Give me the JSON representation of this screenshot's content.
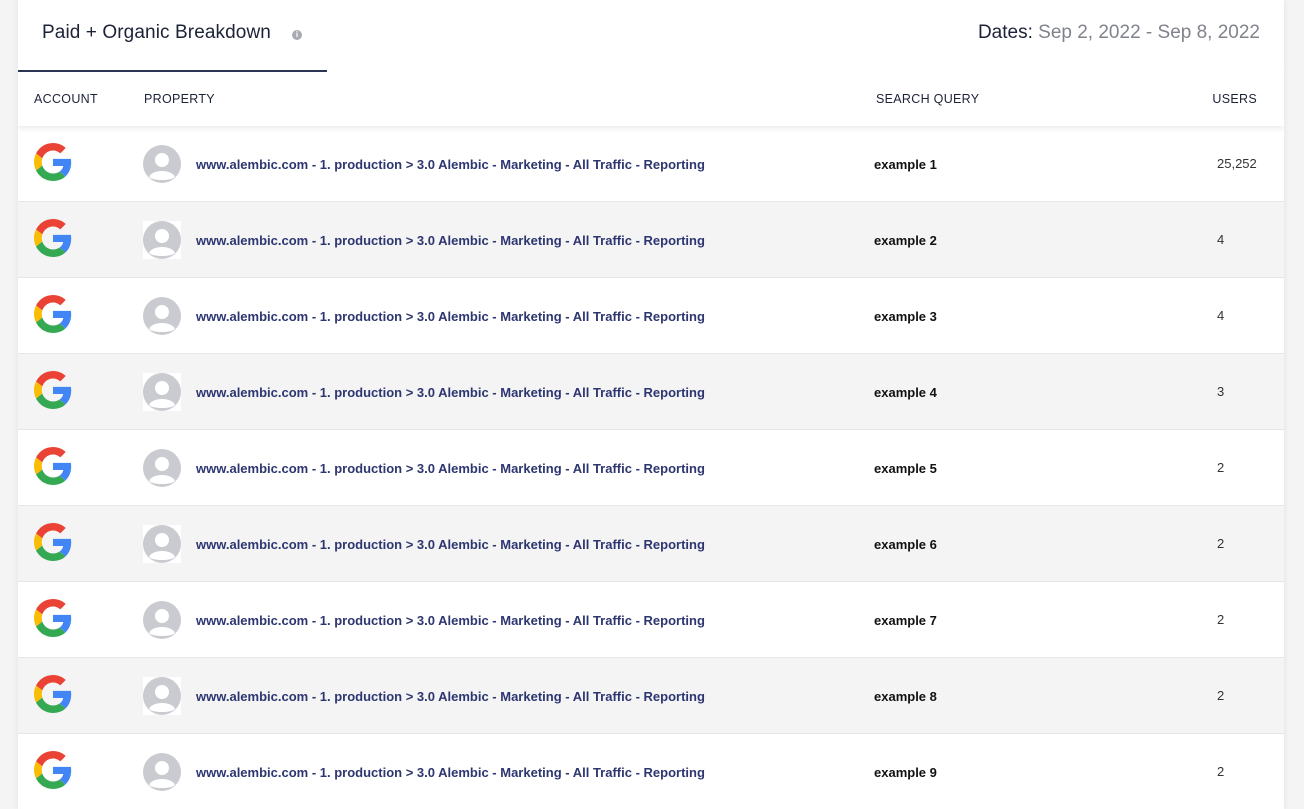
{
  "header": {
    "tab_title": "Paid + Organic Breakdown",
    "info_icon": "info-icon",
    "dates_label": "Dates:",
    "dates_value": "Sep 2, 2022 - Sep 8, 2022"
  },
  "columns": {
    "account": "ACCOUNT",
    "property": "PROPERTY",
    "search_query": "SEARCH QUERY",
    "users": "USERS"
  },
  "rows": [
    {
      "account_icon": "google-icon",
      "avatar_icon": "user-avatar-icon",
      "property": "www.alembic.com - 1. production > 3.0 Alembic - Marketing - All Traffic - Reporting",
      "query": "example 1",
      "users": "25,252"
    },
    {
      "account_icon": "google-icon",
      "avatar_icon": "user-avatar-icon",
      "property": "www.alembic.com - 1. production > 3.0 Alembic - Marketing - All Traffic - Reporting",
      "query": "example 2",
      "users": "4"
    },
    {
      "account_icon": "google-icon",
      "avatar_icon": "user-avatar-icon",
      "property": "www.alembic.com - 1. production > 3.0 Alembic - Marketing - All Traffic - Reporting",
      "query": "example 3",
      "users": "4"
    },
    {
      "account_icon": "google-icon",
      "avatar_icon": "user-avatar-icon",
      "property": "www.alembic.com - 1. production > 3.0 Alembic - Marketing - All Traffic - Reporting",
      "query": "example 4",
      "users": "3"
    },
    {
      "account_icon": "google-icon",
      "avatar_icon": "user-avatar-icon",
      "property": "www.alembic.com - 1. production > 3.0 Alembic - Marketing - All Traffic - Reporting",
      "query": "example 5",
      "users": "2"
    },
    {
      "account_icon": "google-icon",
      "avatar_icon": "user-avatar-icon",
      "property": "www.alembic.com - 1. production > 3.0 Alembic - Marketing - All Traffic - Reporting",
      "query": "example 6",
      "users": "2"
    },
    {
      "account_icon": "google-icon",
      "avatar_icon": "user-avatar-icon",
      "property": "www.alembic.com - 1. production > 3.0 Alembic - Marketing - All Traffic - Reporting",
      "query": "example 7",
      "users": "2"
    },
    {
      "account_icon": "google-icon",
      "avatar_icon": "user-avatar-icon",
      "property": "www.alembic.com - 1. production > 3.0 Alembic - Marketing - All Traffic - Reporting",
      "query": "example 8",
      "users": "2"
    },
    {
      "account_icon": "google-icon",
      "avatar_icon": "user-avatar-icon",
      "property": "www.alembic.com - 1. production > 3.0 Alembic - Marketing - All Traffic - Reporting",
      "query": "example 9",
      "users": "2"
    }
  ],
  "colors": {
    "accent": "#2d3555",
    "property_link": "#2d3670",
    "row_alt": "#f4f4f5",
    "google_blue": "#4285F4",
    "google_red": "#EA4335",
    "google_yellow": "#FBBC05",
    "google_green": "#34A853"
  }
}
